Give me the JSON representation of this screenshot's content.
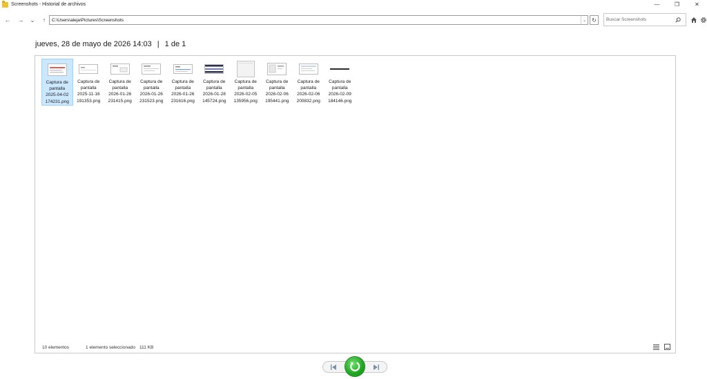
{
  "window": {
    "title": "Screenshots - Historial de archivos",
    "controls": {
      "minimize": "—",
      "maximize": "❐",
      "close": "✕"
    }
  },
  "nav": {
    "back": "←",
    "forward": "→",
    "recent": "⌄",
    "up": "↑"
  },
  "address": {
    "path": "C:\\Users\\aleja\\Pictures\\Screenshots",
    "dropdown": "⌄",
    "refresh": "↻"
  },
  "search": {
    "placeholder": "Buscar Screenshots"
  },
  "heading": {
    "date": "jueves, 28 de mayo de 2026 14:03",
    "separator": "|",
    "page": "1 de 1"
  },
  "files": [
    {
      "line1": "Captura de",
      "line2": "pantalla",
      "line3": "2025-04-02",
      "line4": "174231.png",
      "selected": true
    },
    {
      "line1": "Captura de",
      "line2": "pantalla",
      "line3": "2025-11-16",
      "line4": "191353.png",
      "selected": false
    },
    {
      "line1": "Captura de",
      "line2": "pantalla",
      "line3": "2026-01-26",
      "line4": "231415.png",
      "selected": false
    },
    {
      "line1": "Captura de",
      "line2": "pantalla",
      "line3": "2026-01-26",
      "line4": "231523.png",
      "selected": false
    },
    {
      "line1": "Captura de",
      "line2": "pantalla",
      "line3": "2026-01-26",
      "line4": "231616.png",
      "selected": false
    },
    {
      "line1": "Captura de",
      "line2": "pantalla",
      "line3": "2026-01-28",
      "line4": "145724.png",
      "selected": false
    },
    {
      "line1": "Captura de",
      "line2": "pantalla",
      "line3": "2026-02-05",
      "line4": "135956.png",
      "selected": false
    },
    {
      "line1": "Captura de",
      "line2": "pantalla",
      "line3": "2026-02-06",
      "line4": "195441.png",
      "selected": false
    },
    {
      "line1": "Captura de",
      "line2": "pantalla",
      "line3": "2026-02-06",
      "line4": "200832.png",
      "selected": false
    },
    {
      "line1": "Captura de",
      "line2": "pantalla",
      "line3": "2026-02-09",
      "line4": "184146.png",
      "selected": false
    }
  ],
  "status": {
    "count": "10 elementos",
    "selection": "1 elemento seleccionado",
    "size": "111 KB"
  },
  "colors": {
    "selection_bg": "#cce8ff",
    "selection_border": "#99d1ff",
    "restore_green": "#1fa51f"
  }
}
